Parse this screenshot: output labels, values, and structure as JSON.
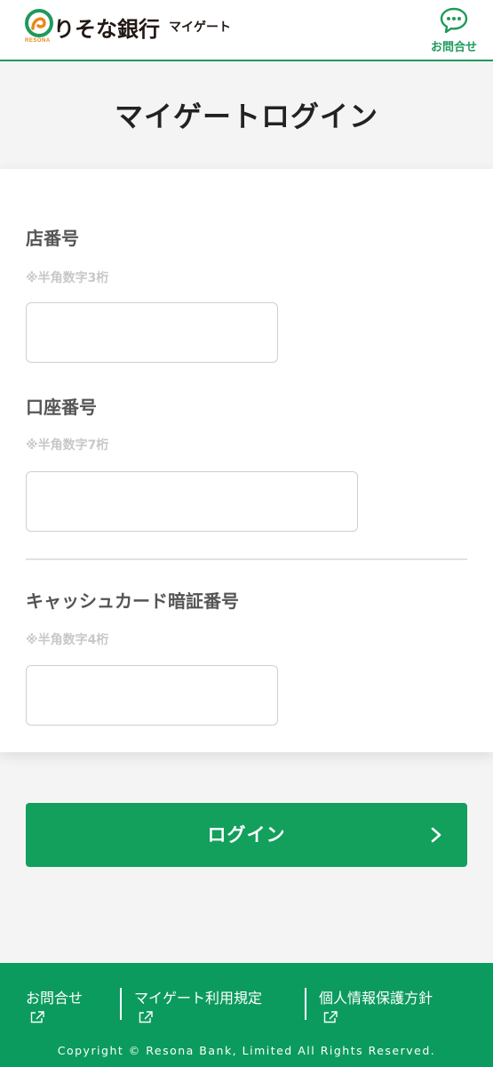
{
  "header": {
    "bank_name": "りそな銀行",
    "logo_sub": "RESONA",
    "service_name": "マイゲート",
    "contact_label": "お問合せ"
  },
  "page": {
    "title": "マイゲートログイン"
  },
  "form": {
    "branch": {
      "label": "店番号",
      "hint": "※半角数字3桁",
      "value": ""
    },
    "account": {
      "label": "口座番号",
      "hint": "※半角数字7桁",
      "value": ""
    },
    "pin": {
      "label": "キャッシュカード暗証番号",
      "hint": "※半角数字4桁",
      "value": ""
    }
  },
  "login_button": {
    "label": "ログイン"
  },
  "footer": {
    "links": [
      {
        "label": "お問合せ"
      },
      {
        "label": "マイゲート利用規定"
      },
      {
        "label": "個人情報保護方針"
      }
    ],
    "copyright": "Copyright © Resona Bank, Limited All Rights Reserved."
  },
  "colors": {
    "brand_green": "#12a05c",
    "footer_green": "#0c9b5e",
    "logo_orange": "#e8891c"
  },
  "icons": {
    "contact": "chat-bubble-icon",
    "external": "external-link-icon",
    "chevron": "chevron-right-icon",
    "logo": "resona-logo-icon"
  }
}
